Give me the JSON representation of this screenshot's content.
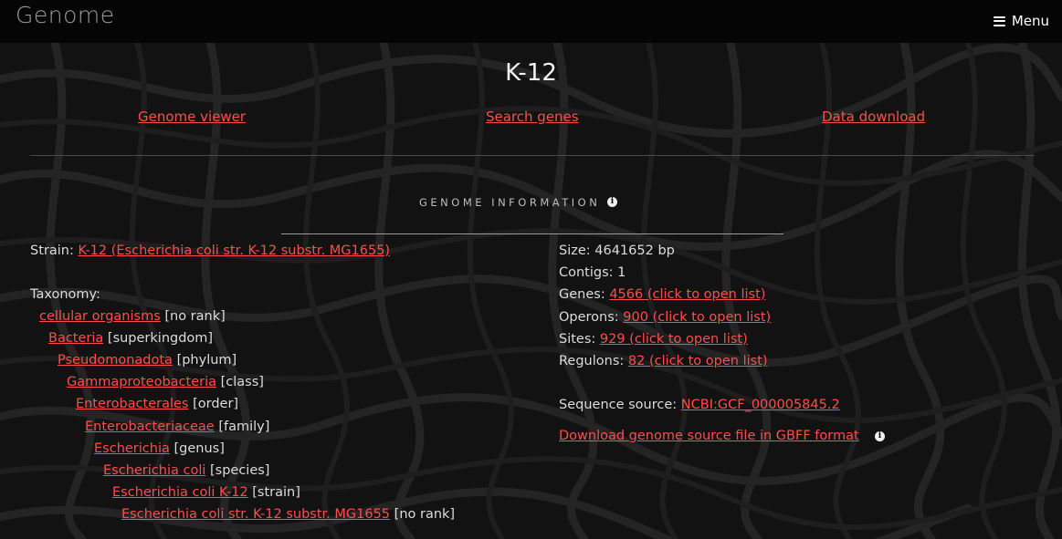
{
  "header": {
    "brand": "Genome",
    "menu_label": "Menu"
  },
  "page": {
    "title": "K-12",
    "nav": {
      "genome_viewer": "Genome viewer",
      "search_genes": "Search genes",
      "data_download": "Data download"
    },
    "section_title": "GENOME INFORMATION"
  },
  "strain": {
    "label": "Strain:",
    "value": "K-12 (Escherichia coli str. K-12 substr. MG1655)"
  },
  "taxonomy": {
    "label": "Taxonomy:",
    "items": [
      {
        "name": "cellular organisms",
        "rank": "[no rank]"
      },
      {
        "name": "Bacteria",
        "rank": "[superkingdom]"
      },
      {
        "name": "Pseudomonadota",
        "rank": "[phylum]"
      },
      {
        "name": "Gammaproteobacteria",
        "rank": "[class]"
      },
      {
        "name": "Enterobacterales",
        "rank": "[order]"
      },
      {
        "name": "Enterobacteriaceae",
        "rank": "[family]"
      },
      {
        "name": "Escherichia",
        "rank": "[genus]"
      },
      {
        "name": "Escherichia coli",
        "rank": "[species]"
      },
      {
        "name": "Escherichia coli K-12",
        "rank": "[strain]"
      },
      {
        "name": "Escherichia coli str. K-12 substr. MG1655",
        "rank": "[no rank]"
      }
    ]
  },
  "stats": {
    "size": "Size: 4641652 bp",
    "contigs": "Contigs: 1",
    "genes_label": "Genes:",
    "genes_link": "4566 (click to open list)",
    "operons_label": "Operons:",
    "operons_link": "900 (click to open list)",
    "sites_label": "Sites:",
    "sites_link": "929 (click to open list)",
    "regulons_label": "Regulons:",
    "regulons_link": "82 (click to open list)",
    "source_label": "Sequence source:",
    "source_link": "NCBI:GCF_000005845.2",
    "download_link": "Download genome source file in GBFF format"
  },
  "colors": {
    "link": "#ff4d4d",
    "text": "#dcdcdc",
    "background": "#121212",
    "header": "#050505"
  },
  "icons": {
    "info": "info-icon",
    "menu": "hamburger-icon"
  }
}
